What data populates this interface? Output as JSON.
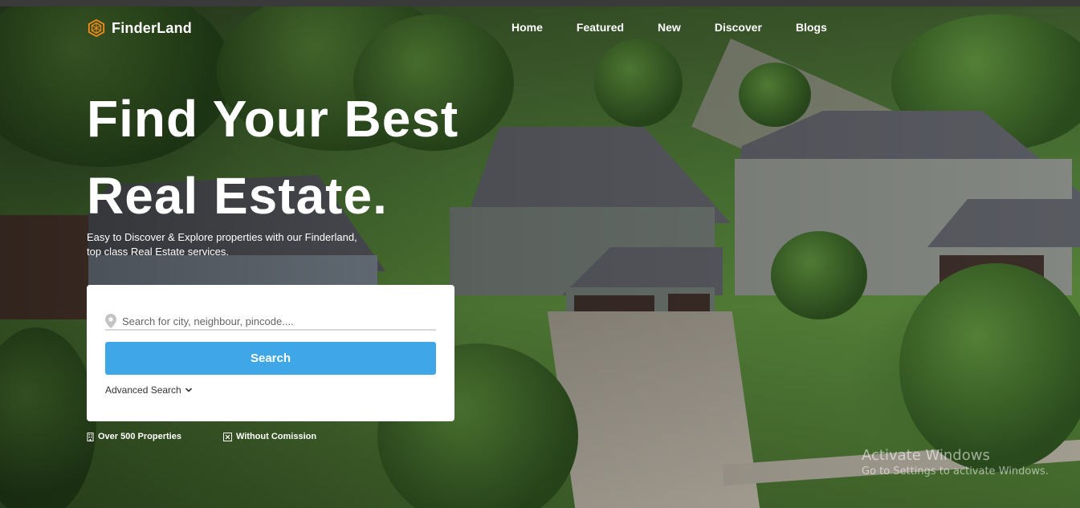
{
  "brand": {
    "name": "FinderLand",
    "accent": "#f28a1a"
  },
  "nav": {
    "items": [
      "Home",
      "Featured",
      "New",
      "Discover",
      "Blogs"
    ]
  },
  "hero": {
    "title_line1": "Find Your Best",
    "title_line2": "Real Estate.",
    "subtitle_line1": "Easy to Discover & Explore properties with our Finderland,",
    "subtitle_line2": "top class Real Estate services."
  },
  "search": {
    "placeholder": "Search for city, neighbour, pincode....",
    "button_label": "Search",
    "button_color": "#3fa6e8",
    "advanced_label": "Advanced Search"
  },
  "features": [
    {
      "icon": "building-icon",
      "label": "Over 500 Properties"
    },
    {
      "icon": "no-commission-icon",
      "label": "Without Comission"
    }
  ],
  "os_watermark": {
    "line1": "Activate Windows",
    "line2": "Go to Settings to activate Windows."
  }
}
